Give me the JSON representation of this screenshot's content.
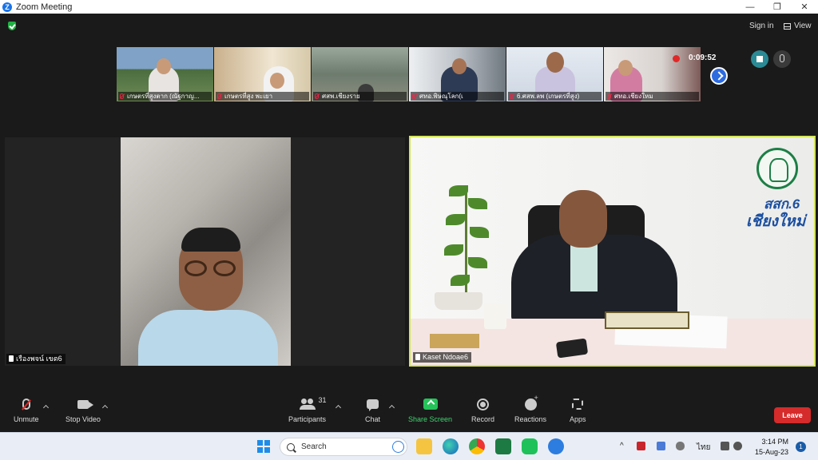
{
  "window": {
    "title": "Zoom Meeting",
    "logo_letter": "Z",
    "minimize": "—",
    "maximize": "❐",
    "close": "✕"
  },
  "topbar": {
    "sign_in": "Sign in",
    "view": "View",
    "recording_timer": "0:09:52"
  },
  "thumbnails": [
    {
      "name": "เกษตรที่สูงตาก (ณัฐกาญ...",
      "bg": "#5d7f54"
    },
    {
      "name": "เกษตรที่สูง พะเยา",
      "bg": "#b69a74"
    },
    {
      "name": "ศสพ.เชียงราย",
      "bg": "#6b7a67"
    },
    {
      "name": "ศทอ.พิษณุโลก(เ",
      "bg": "#8a8f96"
    },
    {
      "name": "6.ศสพ.ลพ (เกษตรที่สูง)",
      "bg": "#d5dbe6"
    },
    {
      "name": "ศทอ.เชียงใหม",
      "bg": "#e7e3e0"
    }
  ],
  "main_videos": {
    "left_name": "เรืองพจน์ เขต6",
    "right_name": "Kaset Ndoae6",
    "right_logo_line1": "สสก.6",
    "right_logo_line2": "เชียงใหม่"
  },
  "toolbar": {
    "unmute": "Unmute",
    "stop_video": "Stop Video",
    "participants": "Participants",
    "participants_count": "31",
    "chat": "Chat",
    "share_screen": "Share Screen",
    "record": "Record",
    "reactions": "Reactions",
    "apps": "Apps",
    "leave": "Leave"
  },
  "taskbar": {
    "search_placeholder": "Search",
    "language": "ไทย",
    "time": "3:14 PM",
    "date": "15-Aug-23",
    "notification_count": "1"
  },
  "colors": {
    "accent_green": "#26c35a",
    "leave_red": "#d52b2b",
    "active_speaker_border": "#d4e55a"
  }
}
